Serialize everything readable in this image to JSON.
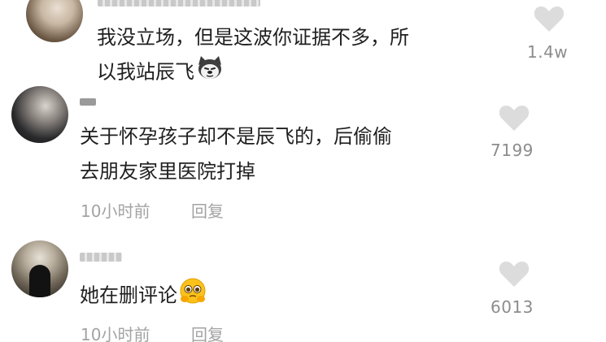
{
  "comments": [
    {
      "text_lines": [
        "我没立场，但是这波你证据不多，所",
        "以我站辰飞"
      ],
      "emoji": "husky-emoji",
      "likes": "1.4w"
    },
    {
      "text_lines": [
        "关于怀孕孩子却不是辰飞的，后偷偷",
        "去朋友家里医院打掉"
      ],
      "time": "10小时前",
      "reply": "回复",
      "likes": "7199"
    },
    {
      "text_lines": [
        "她在删评论"
      ],
      "emoji": "pleading-emoji",
      "time": "10小时前",
      "reply": "回复",
      "likes": "6013"
    }
  ],
  "colors": {
    "text": "#1f1f1f",
    "meta": "#a3a3a3",
    "likes": "#8c8c8c",
    "heart": "#dcdcdc"
  }
}
